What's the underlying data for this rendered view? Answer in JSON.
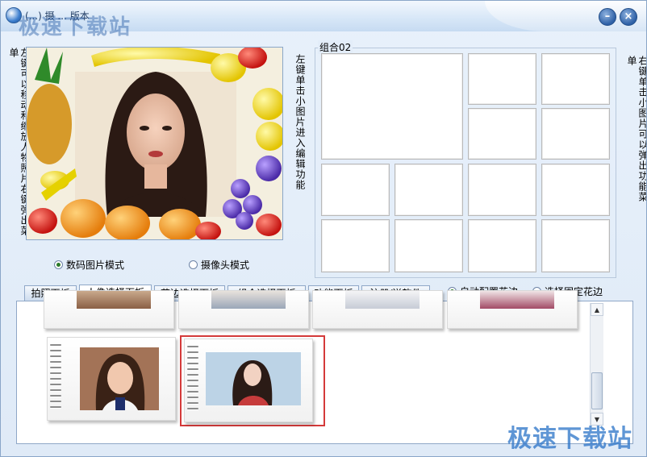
{
  "window": {
    "title": "(...) 摄 ... 版本",
    "watermark_top": "极速下载站",
    "minimize_label": "–",
    "close_label": "×"
  },
  "hints": {
    "left": "左键可以移动和缩放人物照片右键弹出菜单",
    "middle": "左键单击小图片进入编辑功能",
    "right": "右键单击小图片可以弹出功能菜单"
  },
  "group": {
    "title": "组合02"
  },
  "modes": {
    "digital": "数码图片模式",
    "camera": "摄像头模式",
    "selected": "digital"
  },
  "tabs": [
    "拍照面板",
    "人像选择面板",
    "花边选择面板",
    "组合选择面板",
    "功能面板",
    "注册/送软件"
  ],
  "active_tab": 1,
  "frame_options": {
    "auto": "自动配置花边",
    "fixed": "选择固定花边",
    "selected": "auto"
  },
  "watermark_bottom": "极速下载站",
  "icons": {
    "app": "app-globe-icon",
    "minimize": "minimize-icon",
    "close": "close-icon",
    "scroll_up": "scroll-up-icon",
    "scroll_down": "scroll-down-icon"
  },
  "scroll_up_glyph": "▲",
  "scroll_down_glyph": "▼",
  "colors": {
    "accent": "#2d5fa5",
    "selection": "#d43a3a"
  }
}
